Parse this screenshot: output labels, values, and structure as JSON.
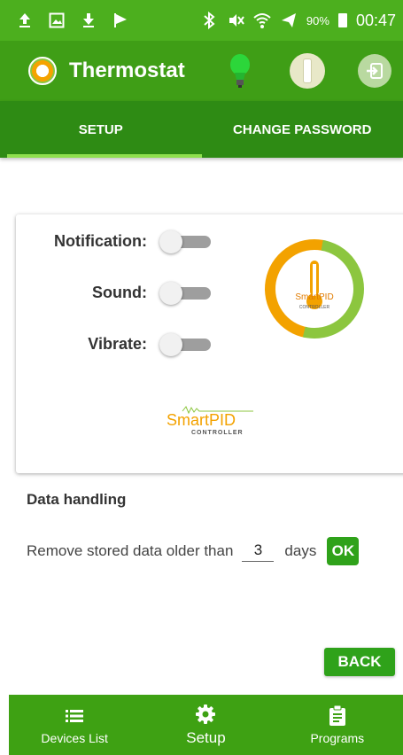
{
  "status_bar": {
    "battery_percent": "90%",
    "time": "00:47",
    "left_icons": [
      "upload-icon",
      "image-icon",
      "download-icon",
      "flag-icon"
    ],
    "right_icons": [
      "bluetooth-icon",
      "mute-icon",
      "wifi-icon",
      "airplane-icon",
      "battery-icon"
    ]
  },
  "app_bar": {
    "title": "Thermostat",
    "actions": [
      "lightbulb-icon",
      "info-icon",
      "logout-icon"
    ]
  },
  "tabs": [
    {
      "label": "SETUP",
      "active": true
    },
    {
      "label": "CHANGE PASSWORD",
      "active": false
    }
  ],
  "settings": [
    {
      "label": "Notification:",
      "enabled": false
    },
    {
      "label": "Sound:",
      "enabled": false
    },
    {
      "label": "Vibrate:",
      "enabled": false
    }
  ],
  "branding": {
    "logo_text": "SmartPID",
    "logo_subtext": "CONTROLLER"
  },
  "data_handling": {
    "title": "Data handling",
    "prefix": "Remove stored data older than",
    "days_value": "3",
    "suffix": "days",
    "ok_label": "OK"
  },
  "back_label": "BACK",
  "bottom_nav": [
    {
      "label": "Devices List",
      "icon": "list-icon",
      "active": false
    },
    {
      "label": "Setup",
      "icon": "gear-icon",
      "active": true
    },
    {
      "label": "Programs",
      "icon": "clipboard-icon",
      "active": false
    }
  ],
  "colors": {
    "primary": "#3f9e16",
    "status_bar": "#4caf1e",
    "tabs": "#2e8b14",
    "tab_indicator": "#8ee04e",
    "button": "#2fa21a"
  }
}
